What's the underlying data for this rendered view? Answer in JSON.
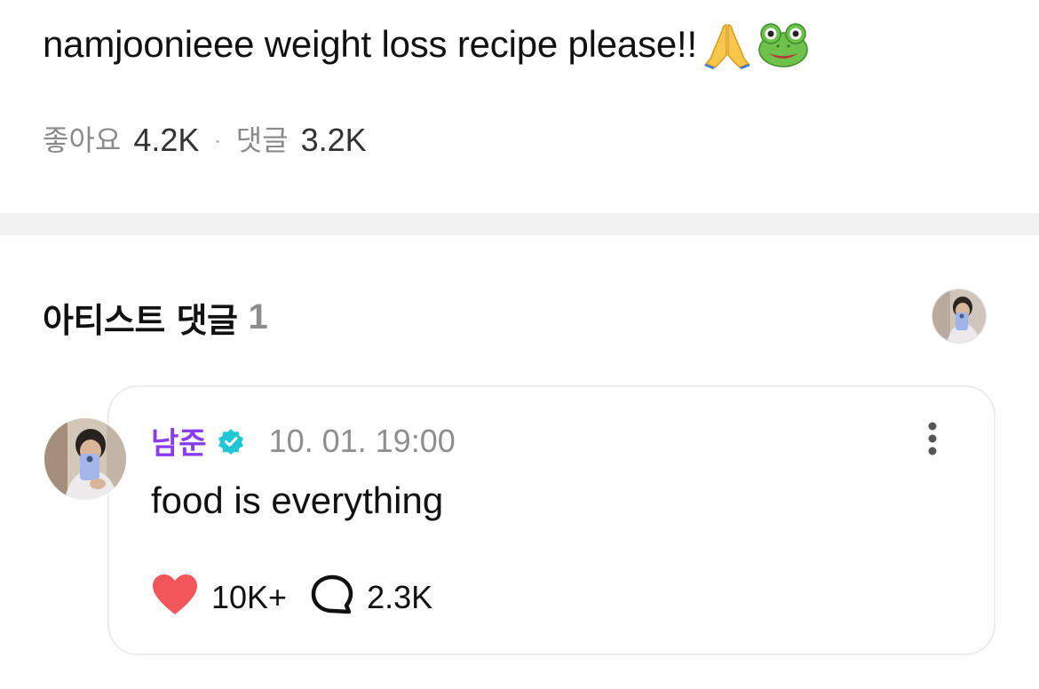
{
  "post": {
    "text": "namjoonieee weight loss recipe please!!",
    "emojis": [
      "folded-hands",
      "frog"
    ],
    "likes_label": "좋아요",
    "likes_count": "4.2K",
    "separator": "·",
    "comments_label": "댓글",
    "comments_count": "3.2K"
  },
  "artist_comments": {
    "title": "아티스트 댓글",
    "count": "1"
  },
  "comment": {
    "author": "남준",
    "timestamp": "10. 01. 19:00",
    "text": "food is everything",
    "likes": "10K+",
    "replies": "2.3K"
  },
  "colors": {
    "author": "#8a3cf0",
    "verified": "#1fc6d6",
    "heart": "#f2555a",
    "band": "#f2f2f2"
  }
}
